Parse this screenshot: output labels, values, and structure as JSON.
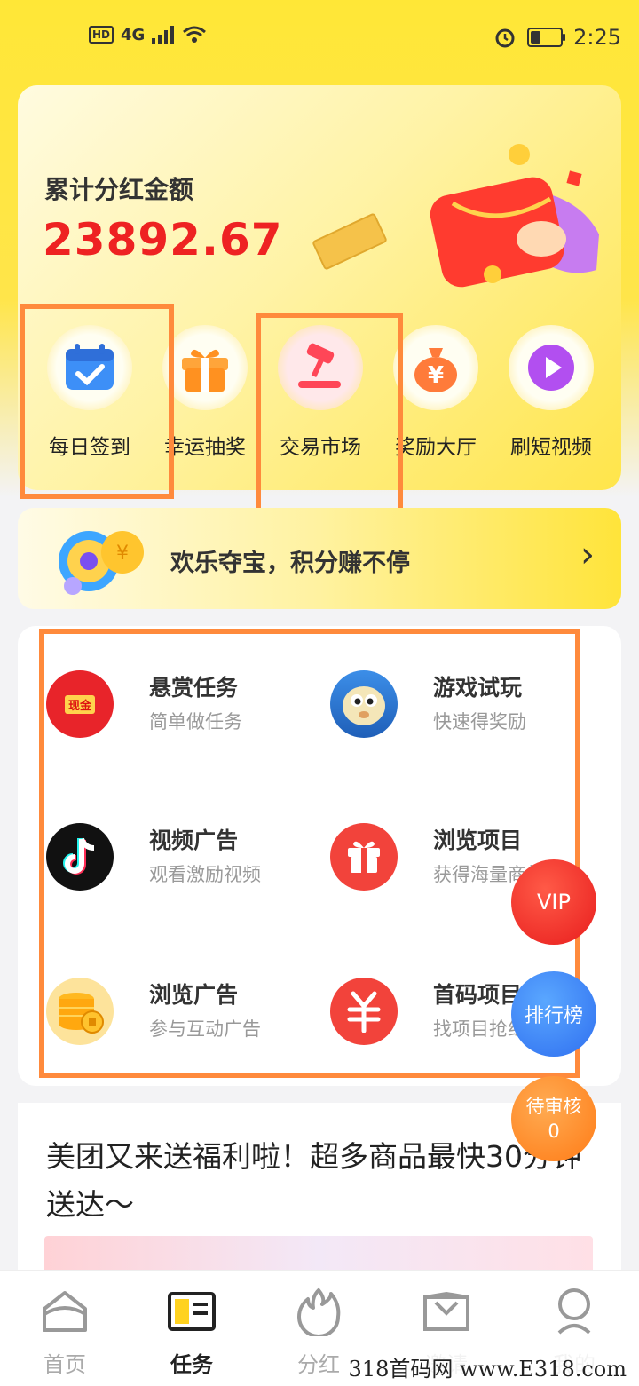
{
  "status_bar": {
    "network": "4G",
    "hd": "HD",
    "time": "2:25",
    "battery_level": 0.35
  },
  "hero": {
    "label": "累计分红金额",
    "amount": "23892.67",
    "features": [
      {
        "label": "每日签到",
        "icon": "calendar-check-icon"
      },
      {
        "label": "幸运抽奖",
        "icon": "gift-box-icon"
      },
      {
        "label": "交易市场",
        "icon": "auction-hammer-icon"
      },
      {
        "label": "奖励大厅",
        "icon": "money-bag-icon"
      },
      {
        "label": "刷短视频",
        "icon": "play-icon"
      }
    ]
  },
  "banner": {
    "text": "欢乐夺宝，积分赚不停",
    "icon": "treasure-coin-icon"
  },
  "tasks": [
    {
      "title": "悬赏任务",
      "subtitle": "简单做任务",
      "icon": "red-envelope-icon",
      "badge": "现金"
    },
    {
      "title": "游戏试玩",
      "subtitle": "快速得奖励",
      "icon": "pufferfish-game-icon"
    },
    {
      "title": "视频广告",
      "subtitle": "观看激励视频",
      "icon": "tiktok-icon"
    },
    {
      "title": "浏览项目",
      "subtitle": "获得海量商机",
      "icon": "gift-icon"
    },
    {
      "title": "浏览广告",
      "subtitle": "参与互动广告",
      "icon": "coin-stack-icon"
    },
    {
      "title": "首码项目",
      "subtitle": "找项目抢红包",
      "icon": "yuan-icon"
    }
  ],
  "floating": {
    "vip": "VIP",
    "rank": "排行榜",
    "review_label": "待审核",
    "review_count": "0"
  },
  "article": {
    "text": "美团又来送福利啦！超多商品最快30分钟送达～"
  },
  "tabs": [
    {
      "label": "首页",
      "icon": "home-icon"
    },
    {
      "label": "任务",
      "icon": "task-book-icon",
      "active": true
    },
    {
      "label": "分红",
      "icon": "flame-icon"
    },
    {
      "label": "邀请",
      "icon": "invite-envelope-icon"
    },
    {
      "label": "我的",
      "icon": "profile-icon"
    }
  ],
  "watermark": "318首码网 www.E318.com",
  "colors": {
    "accent_yellow": "#ffe737",
    "amount_red": "#ee2222",
    "highlight_orange": "#ff8a3c"
  }
}
